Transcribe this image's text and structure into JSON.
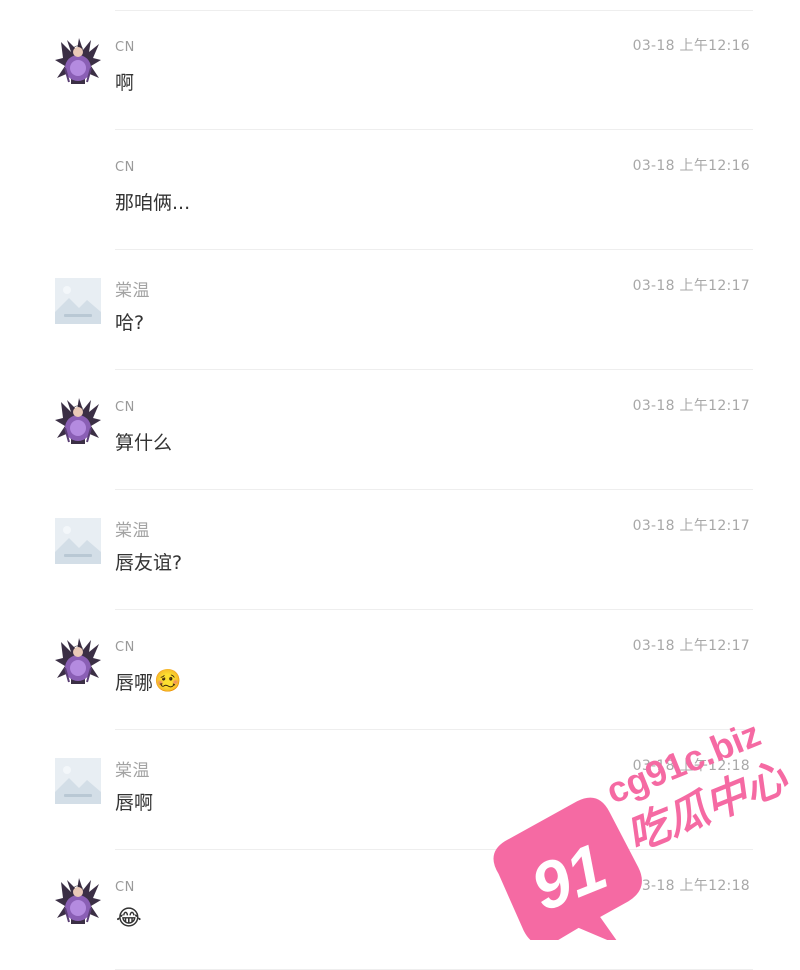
{
  "messages": [
    {
      "sender": "CN",
      "time": "03-18 上午12:16",
      "text": "啊",
      "emoji": "",
      "avatar": "portrait"
    },
    {
      "sender": "CN",
      "time": "03-18 上午12:16",
      "text": "那咱俩...",
      "emoji": "",
      "avatar": "none"
    },
    {
      "sender": "棠温",
      "time": "03-18 上午12:17",
      "text": "哈?",
      "emoji": "",
      "avatar": "placeholder"
    },
    {
      "sender": "CN",
      "time": "03-18 上午12:17",
      "text": "算什么",
      "emoji": "",
      "avatar": "portrait"
    },
    {
      "sender": "棠温",
      "time": "03-18 上午12:17",
      "text": "唇友谊?",
      "emoji": "",
      "avatar": "placeholder"
    },
    {
      "sender": "CN",
      "time": "03-18 上午12:17",
      "text": "唇哪",
      "emoji": "🥴",
      "avatar": "portrait"
    },
    {
      "sender": "棠温",
      "time": "03-18 上午12:18",
      "text": "唇啊",
      "emoji": "",
      "avatar": "placeholder"
    },
    {
      "sender": "CN",
      "time": "03-18 上午12:18",
      "text": "",
      "emoji": "😂",
      "avatar": "portrait"
    }
  ],
  "watermark": {
    "number": "91",
    "domain": "cg91c.biz",
    "name": "吃瓜中心",
    "color": "#f56aa3"
  },
  "icons": {
    "portrait": "user-photo-avatar",
    "placeholder": "image-placeholder-avatar"
  }
}
